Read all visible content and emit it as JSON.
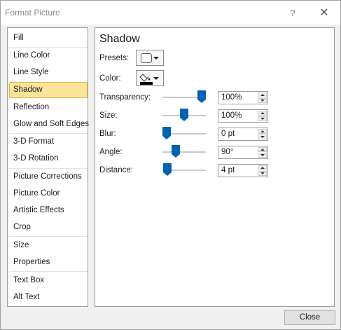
{
  "window": {
    "title": "Format Picture",
    "help_label": "?",
    "close_label": "✕"
  },
  "sidebar": {
    "items": [
      {
        "label": "Fill"
      },
      {
        "label": "Line Color"
      },
      {
        "label": "Line Style"
      },
      {
        "label": "Shadow",
        "selected": true
      },
      {
        "label": "Reflection"
      },
      {
        "label": "Glow and Soft Edges"
      },
      {
        "label": "3-D Format"
      },
      {
        "label": "3-D Rotation"
      },
      {
        "label": "Picture Corrections"
      },
      {
        "label": "Picture Color"
      },
      {
        "label": "Artistic Effects"
      },
      {
        "label": "Crop"
      },
      {
        "label": "Size"
      },
      {
        "label": "Properties"
      },
      {
        "label": "Text Box"
      },
      {
        "label": "Alt Text"
      }
    ]
  },
  "panel": {
    "title": "Shadow",
    "presets_label": "Presets:",
    "color_label": "Color:",
    "colors": {
      "slider_thumb": "#0063b1",
      "selected_item_bg": "#fbe49a",
      "color_swatch": "#000000"
    },
    "settings": [
      {
        "label": "Transparency:",
        "value": "100%",
        "slider_level": 1.0
      },
      {
        "label": "Size:",
        "value": "100%",
        "slider_level": 0.5
      },
      {
        "label": "Blur:",
        "value": "0 pt",
        "slider_level": 0.0
      },
      {
        "label": "Angle:",
        "value": "90°",
        "slider_level": 0.25
      },
      {
        "label": "Distance:",
        "value": "4 pt",
        "slider_level": 0.02
      }
    ]
  },
  "footer": {
    "close_button_label": "Close"
  }
}
